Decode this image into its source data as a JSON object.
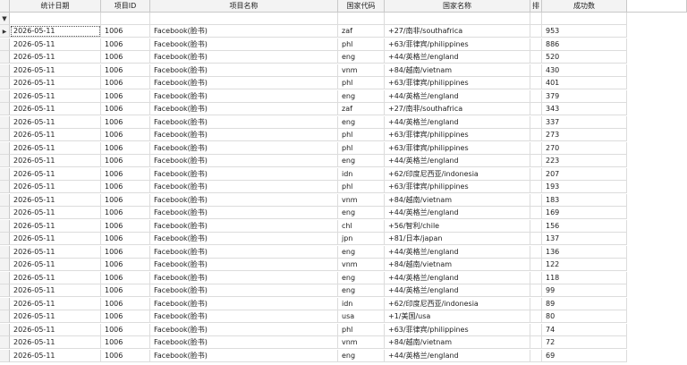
{
  "columns": [
    "统计日期",
    "项目ID",
    "项目名称",
    "国家代码",
    "国家名称",
    "排",
    "成功数"
  ],
  "icons": {
    "filter": "filter-icon",
    "current_row": "current-row-arrow-icon"
  },
  "rows": [
    [
      "2026-05-11",
      "1006",
      "Facebook(脸书)",
      "zaf",
      "+27/南非/southafrica",
      "953"
    ],
    [
      "2026-05-11",
      "1006",
      "Facebook(脸书)",
      "phl",
      "+63/菲律宾/philippines",
      "886"
    ],
    [
      "2026-05-11",
      "1006",
      "Facebook(脸书)",
      "eng",
      "+44/英格兰/england",
      "520"
    ],
    [
      "2026-05-11",
      "1006",
      "Facebook(脸书)",
      "vnm",
      "+84/越南/vietnam",
      "430"
    ],
    [
      "2026-05-11",
      "1006",
      "Facebook(脸书)",
      "phl",
      "+63/菲律宾/philippines",
      "401"
    ],
    [
      "2026-05-11",
      "1006",
      "Facebook(脸书)",
      "eng",
      "+44/英格兰/england",
      "379"
    ],
    [
      "2026-05-11",
      "1006",
      "Facebook(脸书)",
      "zaf",
      "+27/南非/southafrica",
      "343"
    ],
    [
      "2026-05-11",
      "1006",
      "Facebook(脸书)",
      "eng",
      "+44/英格兰/england",
      "337"
    ],
    [
      "2026-05-11",
      "1006",
      "Facebook(脸书)",
      "phl",
      "+63/菲律宾/philippines",
      "273"
    ],
    [
      "2026-05-11",
      "1006",
      "Facebook(脸书)",
      "phl",
      "+63/菲律宾/philippines",
      "270"
    ],
    [
      "2026-05-11",
      "1006",
      "Facebook(脸书)",
      "eng",
      "+44/英格兰/england",
      "223"
    ],
    [
      "2026-05-11",
      "1006",
      "Facebook(脸书)",
      "idn",
      "+62/印度尼西亚/indonesia",
      "207"
    ],
    [
      "2026-05-11",
      "1006",
      "Facebook(脸书)",
      "phl",
      "+63/菲律宾/philippines",
      "193"
    ],
    [
      "2026-05-11",
      "1006",
      "Facebook(脸书)",
      "vnm",
      "+84/越南/vietnam",
      "183"
    ],
    [
      "2026-05-11",
      "1006",
      "Facebook(脸书)",
      "eng",
      "+44/英格兰/england",
      "169"
    ],
    [
      "2026-05-11",
      "1006",
      "Facebook(脸书)",
      "chl",
      "+56/智利/chile",
      "156"
    ],
    [
      "2026-05-11",
      "1006",
      "Facebook(脸书)",
      "jpn",
      "+81/日本/japan",
      "137"
    ],
    [
      "2026-05-11",
      "1006",
      "Facebook(脸书)",
      "eng",
      "+44/英格兰/england",
      "136"
    ],
    [
      "2026-05-11",
      "1006",
      "Facebook(脸书)",
      "vnm",
      "+84/越南/vietnam",
      "122"
    ],
    [
      "2026-05-11",
      "1006",
      "Facebook(脸书)",
      "eng",
      "+44/英格兰/england",
      "118"
    ],
    [
      "2026-05-11",
      "1006",
      "Facebook(脸书)",
      "eng",
      "+44/英格兰/england",
      "99"
    ],
    [
      "2026-05-11",
      "1006",
      "Facebook(脸书)",
      "idn",
      "+62/印度尼西亚/indonesia",
      "89"
    ],
    [
      "2026-05-11",
      "1006",
      "Facebook(脸书)",
      "usa",
      "+1/美国/usa",
      "80"
    ],
    [
      "2026-05-11",
      "1006",
      "Facebook(脸书)",
      "phl",
      "+63/菲律宾/philippines",
      "74"
    ],
    [
      "2026-05-11",
      "1006",
      "Facebook(脸书)",
      "vnm",
      "+84/越南/vietnam",
      "72"
    ],
    [
      "2026-05-11",
      "1006",
      "Facebook(脸书)",
      "eng",
      "+44/英格兰/england",
      "69"
    ]
  ]
}
